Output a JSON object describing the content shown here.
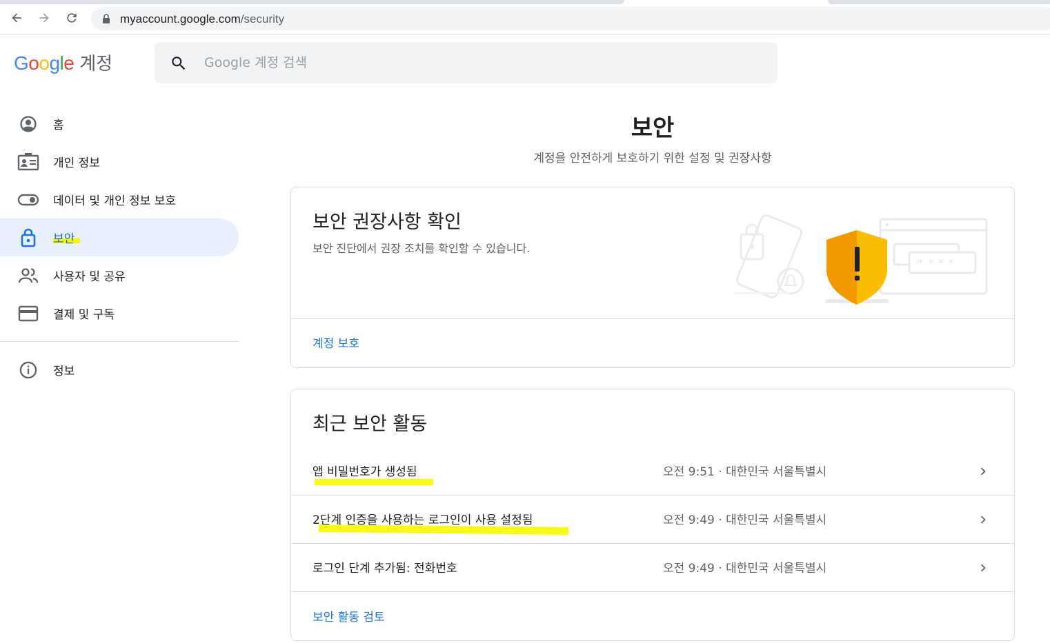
{
  "browser": {
    "url_host": "myaccount.google.com",
    "url_path": "/security"
  },
  "header": {
    "logo_google": [
      "G",
      "o",
      "o",
      "g",
      "l",
      "e"
    ],
    "logo_colors": [
      "#4285F4",
      "#EA4335",
      "#FBBC05",
      "#4285F4",
      "#34A853",
      "#EA4335"
    ],
    "product": "계정",
    "search_placeholder": "Google 계정 검색"
  },
  "sidebar": {
    "items": [
      {
        "label": "홈",
        "icon": "account-circle-icon"
      },
      {
        "label": "개인 정보",
        "icon": "id-card-icon"
      },
      {
        "label": "데이터 및 개인 정보 보호",
        "icon": "toggle-icon"
      },
      {
        "label": "보안",
        "icon": "lock-icon",
        "active": true
      },
      {
        "label": "사용자 및 공유",
        "icon": "people-icon"
      },
      {
        "label": "결제 및 구독",
        "icon": "credit-card-icon"
      }
    ],
    "info": {
      "label": "정보",
      "icon": "info-icon"
    }
  },
  "main": {
    "title": "보안",
    "subtitle": "계정을 안전하게 보호하기 위한 설정 및 권장사항",
    "checkup": {
      "title": "보안 권장사항 확인",
      "description": "보안 진단에서 권장 조치를 확인할 수 있습니다.",
      "link": "계정 보호"
    },
    "recent": {
      "title": "최근 보안 활동",
      "rows": [
        {
          "title": "앱 비밀번호가 생성됨",
          "meta": "오전 9:51 · 대한민국 서울특별시"
        },
        {
          "title": "2단계 인증을 사용하는 로그인이 사용 설정됨",
          "meta": "오전 9:49 · 대한민국 서울특별시"
        },
        {
          "title": "로그인 단계 추가됨: 전화번호",
          "meta": "오전 9:49 · 대한민국 서울특별시"
        }
      ],
      "link": "보안 활동 검토"
    }
  },
  "colors": {
    "accent": "#1a73e8",
    "active_bg": "#e8f0fe",
    "highlight": "#f7f700",
    "shield": "#f9ab00"
  }
}
